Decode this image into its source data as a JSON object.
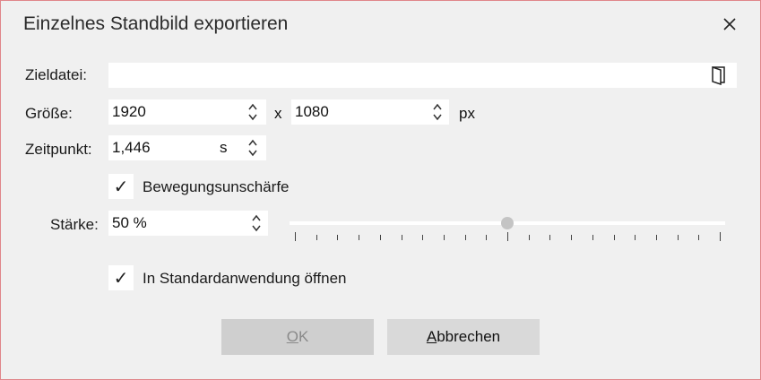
{
  "dialog": {
    "title": "Einzelnes Standbild exportieren"
  },
  "target_file": {
    "label": "Zieldatei:",
    "value": "",
    "placeholder": ""
  },
  "size": {
    "label": "Größe:",
    "width": "1920",
    "separator": "x",
    "height": "1080",
    "unit": "px"
  },
  "time": {
    "label": "Zeitpunkt:",
    "value": "1,446",
    "unit": "s"
  },
  "motion_blur": {
    "checked": true,
    "check_glyph": "✓",
    "label": "Bewegungsunschärfe"
  },
  "strength": {
    "label": "Stärke:",
    "value": "50 %",
    "slider_fraction": 0.5,
    "tick_count": 21
  },
  "open_default": {
    "checked": true,
    "check_glyph": "✓",
    "label": "In Standardanwendung öffnen"
  },
  "buttons": {
    "ok_mnemonic": "O",
    "ok_rest": "K",
    "cancel_mnemonic": "A",
    "cancel_rest": "bbrechen"
  },
  "icons": {
    "close": "close-icon",
    "browse": "folder-door-icon",
    "spinner": "spinner-arrows-icon"
  }
}
